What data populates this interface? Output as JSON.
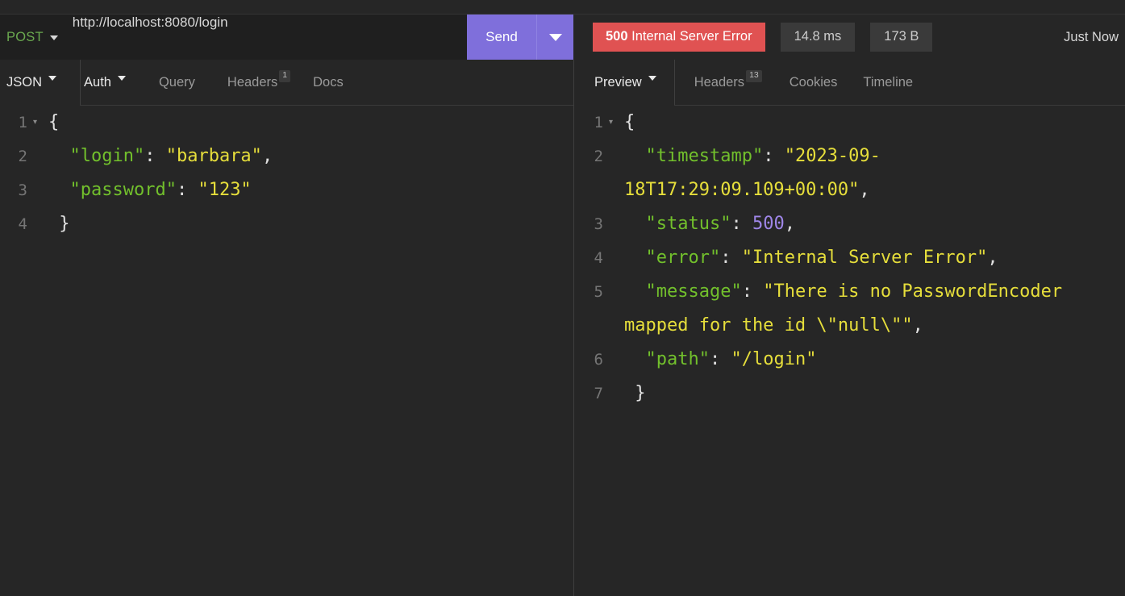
{
  "colors": {
    "background": "#262626",
    "urlbar_background": "#1f1f1f",
    "send_accent": "#7f6fdb",
    "status_error": "#e05252",
    "pill_background": "#3a3a3a",
    "token_key": "#72c02c",
    "token_string": "#e6de3b",
    "token_number": "#9f86e8",
    "method_color": "#6aa84f"
  },
  "request_bar": {
    "method": "POST",
    "method_caret_icon": "chevron-down-icon",
    "url": "http://localhost:8080/login",
    "send_label": "Send",
    "send_caret_icon": "chevron-down-icon"
  },
  "response_status": {
    "status_code": "500",
    "status_text": " Internal Server Error",
    "time": "14.8 ms",
    "size": "173 B",
    "when": "Just Now"
  },
  "request_tabs": {
    "body_type": "JSON",
    "body_type_caret_icon": "chevron-down-icon",
    "items": [
      {
        "label": "Auth",
        "badge": "",
        "caret": true,
        "active": true
      },
      {
        "label": "Query",
        "badge": "",
        "caret": false,
        "active": false
      },
      {
        "label": "Headers",
        "badge": "1",
        "caret": false,
        "active": false
      },
      {
        "label": "Docs",
        "badge": "",
        "caret": false,
        "active": false
      }
    ]
  },
  "response_tabs": {
    "view": "Preview",
    "view_caret_icon": "chevron-down-icon",
    "items": [
      {
        "label": "Headers",
        "badge": "13",
        "caret": false,
        "active": false
      },
      {
        "label": "Cookies",
        "badge": "",
        "caret": false,
        "active": false
      },
      {
        "label": "Timeline",
        "badge": "",
        "caret": false,
        "active": false
      }
    ]
  },
  "request_body": {
    "lines": [
      {
        "n": "1",
        "fold": "▾",
        "tokens": [
          {
            "t": "{",
            "c": "tok-brace"
          }
        ]
      },
      {
        "n": "2",
        "fold": "",
        "tokens": [
          {
            "t": "  ",
            "c": "tok-punc"
          },
          {
            "t": "\"login\"",
            "c": "tok-key"
          },
          {
            "t": ": ",
            "c": "tok-punc"
          },
          {
            "t": "\"barbara\"",
            "c": "tok-str"
          },
          {
            "t": ",",
            "c": "tok-punc"
          }
        ]
      },
      {
        "n": "3",
        "fold": "",
        "tokens": [
          {
            "t": "  ",
            "c": "tok-punc"
          },
          {
            "t": "\"password\"",
            "c": "tok-key"
          },
          {
            "t": ": ",
            "c": "tok-punc"
          },
          {
            "t": "\"123\"",
            "c": "tok-str"
          }
        ]
      },
      {
        "n": "4",
        "fold": "",
        "tokens": [
          {
            "t": " }",
            "c": "tok-brace"
          }
        ]
      }
    ]
  },
  "response_body": {
    "lines": [
      {
        "n": "1",
        "fold": "▾",
        "tokens": [
          {
            "t": "{",
            "c": "tok-brace"
          }
        ]
      },
      {
        "n": "2",
        "fold": "",
        "tokens": [
          {
            "t": "  ",
            "c": "tok-punc"
          },
          {
            "t": "\"timestamp\"",
            "c": "tok-key"
          },
          {
            "t": ": ",
            "c": "tok-punc"
          },
          {
            "t": "\"2023-09-18T17:29:09.109+00:00\"",
            "c": "tok-str"
          },
          {
            "t": ",",
            "c": "tok-punc"
          }
        ]
      },
      {
        "n": "3",
        "fold": "",
        "tokens": [
          {
            "t": "  ",
            "c": "tok-punc"
          },
          {
            "t": "\"status\"",
            "c": "tok-key"
          },
          {
            "t": ": ",
            "c": "tok-punc"
          },
          {
            "t": "500",
            "c": "tok-num"
          },
          {
            "t": ",",
            "c": "tok-punc"
          }
        ]
      },
      {
        "n": "4",
        "fold": "",
        "tokens": [
          {
            "t": "  ",
            "c": "tok-punc"
          },
          {
            "t": "\"error\"",
            "c": "tok-key"
          },
          {
            "t": ": ",
            "c": "tok-punc"
          },
          {
            "t": "\"Internal Server Error\"",
            "c": "tok-str"
          },
          {
            "t": ",",
            "c": "tok-punc"
          }
        ]
      },
      {
        "n": "5",
        "fold": "",
        "tokens": [
          {
            "t": "  ",
            "c": "tok-punc"
          },
          {
            "t": "\"message\"",
            "c": "tok-key"
          },
          {
            "t": ": ",
            "c": "tok-punc"
          },
          {
            "t": "\"There is no PasswordEncoder mapped for the id \\\"null\\\"\"",
            "c": "tok-str"
          },
          {
            "t": ",",
            "c": "tok-punc"
          }
        ]
      },
      {
        "n": "6",
        "fold": "",
        "tokens": [
          {
            "t": "  ",
            "c": "tok-punc"
          },
          {
            "t": "\"path\"",
            "c": "tok-key"
          },
          {
            "t": ": ",
            "c": "tok-punc"
          },
          {
            "t": "\"/login\"",
            "c": "tok-str"
          }
        ]
      },
      {
        "n": "7",
        "fold": "",
        "tokens": [
          {
            "t": " }",
            "c": "tok-brace"
          }
        ]
      }
    ]
  }
}
